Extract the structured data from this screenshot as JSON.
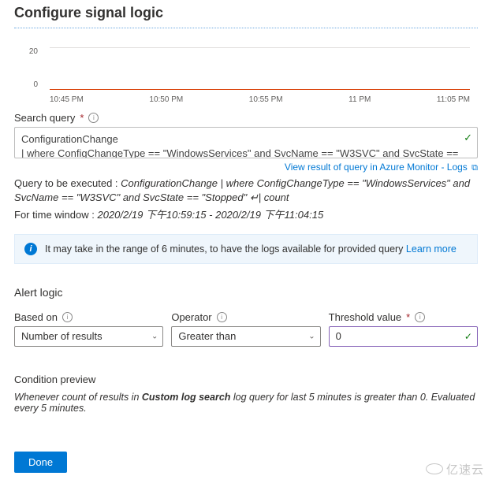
{
  "header": {
    "title": "Configure signal logic"
  },
  "chart_data": {
    "type": "line",
    "x": [
      "10:45 PM",
      "10:50 PM",
      "10:55 PM",
      "11 PM",
      "11:05 PM"
    ],
    "y_ticks": [
      0,
      20
    ],
    "values": [
      0,
      0,
      0,
      0,
      0
    ],
    "ylim": [
      0,
      25
    ]
  },
  "query": {
    "label": "Search query",
    "line1": "ConfigurationChange",
    "line2": "| where ConfigChangeType == \"WindowsServices\" and SvcName  == \"W3SVC\" and SvcState == \"Stopped\""
  },
  "result_link": {
    "text": "View result of query in Azure Monitor - Logs"
  },
  "exec": {
    "prefix": "Query to be executed : ",
    "body": "ConfigurationChange | where ConfigChangeType == \"WindowsServices\" and SvcName == \"W3SVC\" and SvcState == \"Stopped\" ↵| count"
  },
  "time_window": {
    "prefix": "For time window : ",
    "body": "2020/2/19 下午10:59:15 - 2020/2/19 下午11:04:15"
  },
  "info_banner": {
    "text": "It may take in the range of 6 minutes, to have the logs available for provided query",
    "link": "Learn more"
  },
  "alert_logic": {
    "title": "Alert logic"
  },
  "based_on": {
    "label": "Based on",
    "value": "Number of results"
  },
  "operator": {
    "label": "Operator",
    "value": "Greater than"
  },
  "threshold": {
    "label": "Threshold value",
    "value": "0"
  },
  "condition_preview": {
    "title": "Condition preview",
    "p1": "Whenever count of results in ",
    "bold": "Custom log search",
    "p2": " log query for last 5 minutes is greater than 0. Evaluated every 5 minutes."
  },
  "footer": {
    "done": "Done"
  },
  "watermark": {
    "text": "亿速云"
  }
}
